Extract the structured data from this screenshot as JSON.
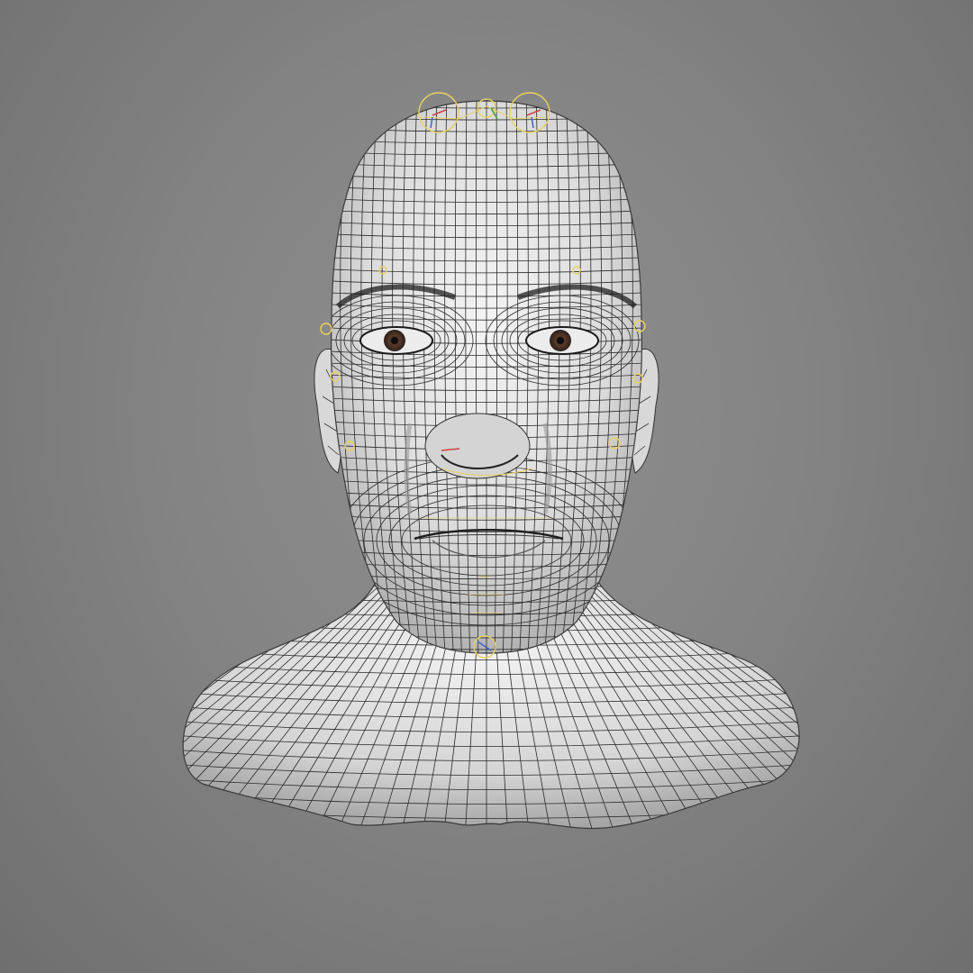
{
  "viewport": {
    "background_top": "#8a8a8a",
    "background_bottom": "#6e6e6e"
  },
  "model": {
    "display_mode": "wireframe-on-shaded",
    "surface_color": "#e4e4e4",
    "wire_color": "#2a2a2a",
    "rig_control_color": "#e8d060",
    "rig_accent_colors": [
      "#d04040",
      "#4060d0",
      "#40a040"
    ]
  }
}
